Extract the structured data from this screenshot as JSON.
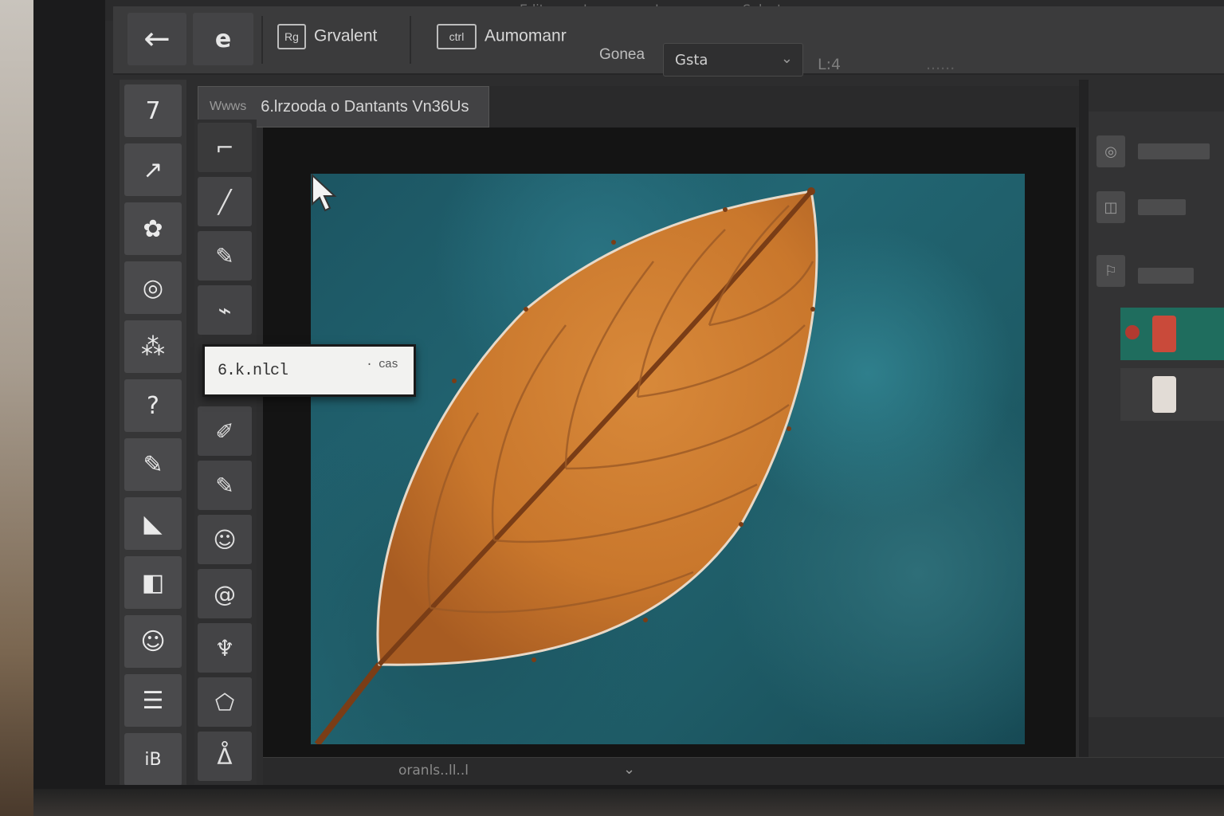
{
  "menu": {
    "items": [
      "Edit",
      "Image",
      "Layer",
      "Select"
    ]
  },
  "options_bar": {
    "back_icon": "arrow-left-icon",
    "e_label": "e",
    "gradient_label": "Grvalent",
    "gradient_icon_text": "Rg",
    "automation_label": "Aumomanr",
    "automation_icon_text": "ctrl",
    "mode_label": "Gonea",
    "dropdown_value": "Gsta",
    "extra_label": "L:4",
    "extra_faded": "......"
  },
  "document": {
    "tab_prefix": "Wwws",
    "tab_title": "6.lrzooda  o Dantants Vn36Us"
  },
  "tools": {
    "primary": [
      "7",
      "↗",
      "✿",
      "◎",
      "⁂",
      "?",
      "✎",
      "◣",
      "◧",
      "☺",
      "☰",
      "iB"
    ],
    "secondary": [
      "⌐",
      "╱",
      "✎",
      "⌁",
      "✐",
      "✎",
      "☺",
      "@",
      "♆",
      "⬠",
      "ᐂ"
    ],
    "tooltip_label": "6.k.nlcl",
    "tooltip_shortcut": "· cas"
  },
  "status": {
    "bottom_text": "oranls..ll..l",
    "chevron_icon": "chevron-down-icon"
  },
  "colors": {
    "leaf": "#c9772c",
    "leaf_dark": "#8a4a1c",
    "background_teal": "#226673",
    "accent_green": "#1f6d5e",
    "layer_red": "#c94a3a"
  }
}
